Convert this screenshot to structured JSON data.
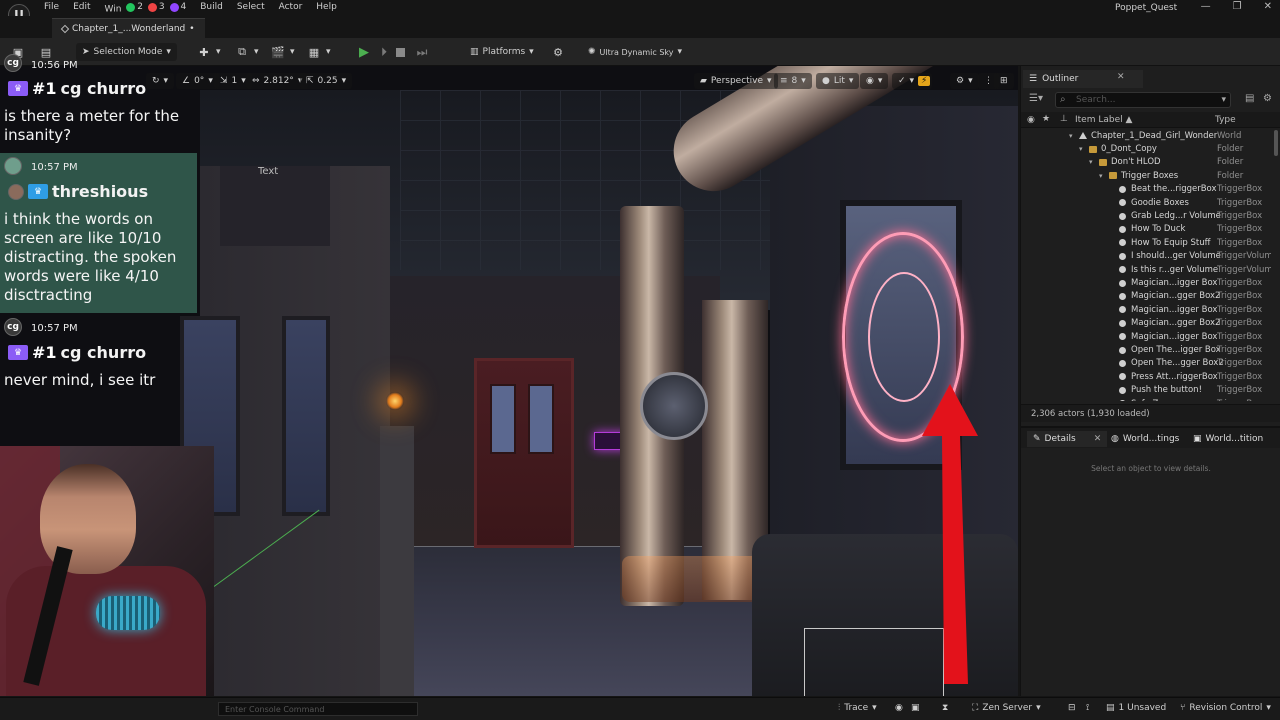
{
  "menubar": {
    "menus": [
      "File",
      "Edit",
      "Win",
      "Build",
      "Select",
      "Actor",
      "Help"
    ],
    "badge_counts": [
      "2",
      "3",
      "4"
    ],
    "project_name": "Poppet_Quest",
    "window_controls": [
      "—",
      "❐",
      "✕"
    ]
  },
  "tabbar": {
    "level_tab": "Chapter_1_...Wonderland",
    "modified_mark": "•"
  },
  "toolbar": {
    "selection_mode": "Selection Mode",
    "platforms": "Platforms",
    "ultra_dynamic_sky": "Ultra Dynamic Sky"
  },
  "viewport_toolbar": {
    "rotation_snap": "0°",
    "scale_snap": "1",
    "camera_speed": "2.812°",
    "grid_size": "0.25",
    "perspective": "Perspective",
    "fov_value": "8",
    "view_mode": "Lit",
    "scene_text_label": "Text"
  },
  "chat": {
    "messages": [
      {
        "time": "10:56 PM",
        "avatar": "cg",
        "rank": "#1",
        "user": "cg churro",
        "text": "is there a meter for the insanity?"
      },
      {
        "time": "10:57 PM",
        "avatar": "",
        "rank": "",
        "user": "threshious",
        "text": "i think the words on screen are like 10/10 distracting. the spoken words were like 4/10 disctracting"
      },
      {
        "time": "10:57 PM",
        "avatar": "cg",
        "rank": "#1",
        "user": "cg churro",
        "text": "never mind, i see itr"
      }
    ]
  },
  "outliner": {
    "tab_title": "Outliner",
    "search_placeholder": "Search...",
    "col_label": "Item Label ▲",
    "col_type": "Type",
    "rows": [
      {
        "label": "Chapter_1_Dead_Girl_Wonder",
        "type": "World",
        "icon": "world",
        "indent": 0
      },
      {
        "label": "0_Dont_Copy",
        "type": "Folder",
        "icon": "folder",
        "indent": 1
      },
      {
        "label": "Don't HLOD",
        "type": "Folder",
        "icon": "folder",
        "indent": 2
      },
      {
        "label": "Trigger Boxes",
        "type": "Folder",
        "icon": "folder",
        "indent": 3
      },
      {
        "label": "Beat the...riggerBox",
        "type": "TriggerBox",
        "icon": "tbox",
        "indent": 4
      },
      {
        "label": "Goodie Boxes",
        "type": "TriggerBox",
        "icon": "tbox",
        "indent": 4
      },
      {
        "label": "Grab Ledg...r Volume",
        "type": "TriggerBox",
        "icon": "tbox",
        "indent": 4
      },
      {
        "label": "How To Duck",
        "type": "TriggerBox",
        "icon": "tbox",
        "indent": 4
      },
      {
        "label": "How To Equip Stuff",
        "type": "TriggerBox",
        "icon": "tbox",
        "indent": 4
      },
      {
        "label": "I should...ger Volume",
        "type": "TriggerVolum",
        "icon": "tbox",
        "indent": 4
      },
      {
        "label": "Is this r...ger Volume",
        "type": "TriggerVolum",
        "icon": "tbox",
        "indent": 4
      },
      {
        "label": "Magician...igger Box",
        "type": "TriggerBox",
        "icon": "tbox",
        "indent": 4
      },
      {
        "label": "Magician...gger Box2",
        "type": "TriggerBox",
        "icon": "tbox",
        "indent": 4
      },
      {
        "label": "Magician...igger Box",
        "type": "TriggerBox",
        "icon": "tbox",
        "indent": 4
      },
      {
        "label": "Magician...gger Box2",
        "type": "TriggerBox",
        "icon": "tbox",
        "indent": 4
      },
      {
        "label": "Magician...igger Box",
        "type": "TriggerBox",
        "icon": "tbox",
        "indent": 4
      },
      {
        "label": "Open The...igger Box",
        "type": "TriggerBox",
        "icon": "tbox",
        "indent": 4
      },
      {
        "label": "Open The...gger Box2",
        "type": "TriggerBox",
        "icon": "tbox",
        "indent": 4
      },
      {
        "label": "Press Att...riggerBox",
        "type": "TriggerBox",
        "icon": "tbox",
        "indent": 4
      },
      {
        "label": "Push the button!",
        "type": "TriggerBox",
        "icon": "tbox",
        "indent": 4
      },
      {
        "label": "Safe Zone",
        "type": "TriggerBox",
        "icon": "tbox",
        "indent": 4
      }
    ],
    "actor_count": "2,306 actors (1,930 loaded)"
  },
  "details": {
    "tabs": [
      "Details",
      "World...tings",
      "World...tition"
    ],
    "empty_hint": "Select an object to view details."
  },
  "statusbar": {
    "console_placeholder": "Enter Console Command",
    "trace": "Trace",
    "zen_server": "Zen Server",
    "unsaved": "1 Unsaved",
    "revision_control": "Revision Control"
  },
  "colors": {
    "accent_snap": "#e5a51a",
    "play_green": "#4caf50",
    "chat_highlight": "#2f5549",
    "arrow_red": "#e3121b"
  }
}
